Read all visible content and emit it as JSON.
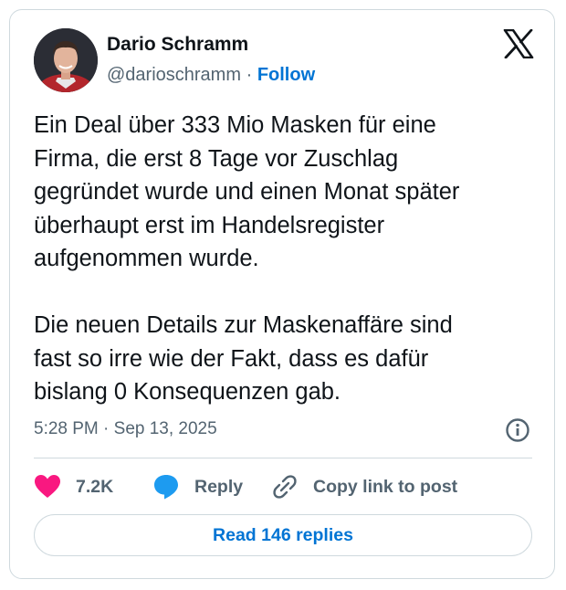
{
  "author": {
    "name": "Dario Schramm",
    "handle": "@darioschramm",
    "separator": "·",
    "follow_label": "Follow"
  },
  "tweet": {
    "text": "Ein Deal über 333 Mio Masken für eine\nFirma, die erst 8 Tage vor Zuschlag\ngegründet wurde und einen Monat später\nüberhaupt erst im Handelsregister\naufgenommen wurde.\n\nDie neuen Details zur Maskenaffäre sind\nfast so irre wie der Fakt, dass es dafür\nbislang 0 Konsequenzen gab.",
    "timestamp": "5:28 PM · Sep 13, 2025"
  },
  "actions": {
    "like_count": "7.2K",
    "reply_label": "Reply",
    "copy_label": "Copy link to post"
  },
  "read_replies_label": "Read 146 replies",
  "colors": {
    "accent": "#0074d4",
    "like": "#f91880",
    "reply": "#1d9bf0",
    "muted": "#536471",
    "text": "#0f1419",
    "border": "#cfd9de"
  },
  "icons": [
    "x-logo-icon",
    "info-icon",
    "heart-icon",
    "reply-bubble-icon",
    "link-icon"
  ]
}
